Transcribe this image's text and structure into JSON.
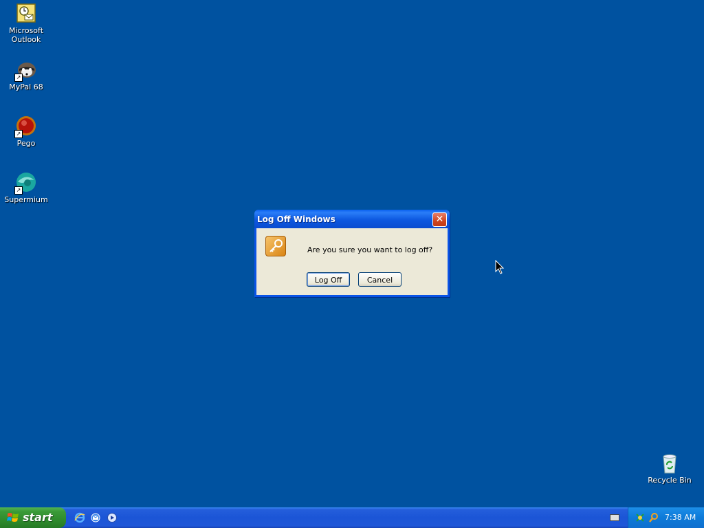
{
  "desktop": {
    "icons": [
      {
        "label_line1": "Microsoft",
        "label_line2": "Outlook",
        "icon": "outlook-icon"
      },
      {
        "label_line1": "MyPal 68",
        "icon": "mypal-icon"
      },
      {
        "label_line1": "Pego",
        "icon": "pego-icon"
      },
      {
        "label_line1": "Supermium",
        "icon": "supermium-icon"
      },
      {
        "label_line1": "Recycle Bin",
        "icon": "recycle-bin-icon"
      }
    ]
  },
  "dialog": {
    "title": "Log Off Windows",
    "close_glyph": "✕",
    "message": "Are you sure you want to log off?",
    "logoff_label": "Log Off",
    "cancel_label": "Cancel"
  },
  "taskbar": {
    "start_label": "start",
    "clock": "7:38 AM"
  },
  "colors": {
    "desktop": "#0052a0",
    "taskbar": "#245edb",
    "start": "#3a9a38",
    "titlebar": "#0a54e6",
    "dialog_body": "#ece9d8"
  }
}
